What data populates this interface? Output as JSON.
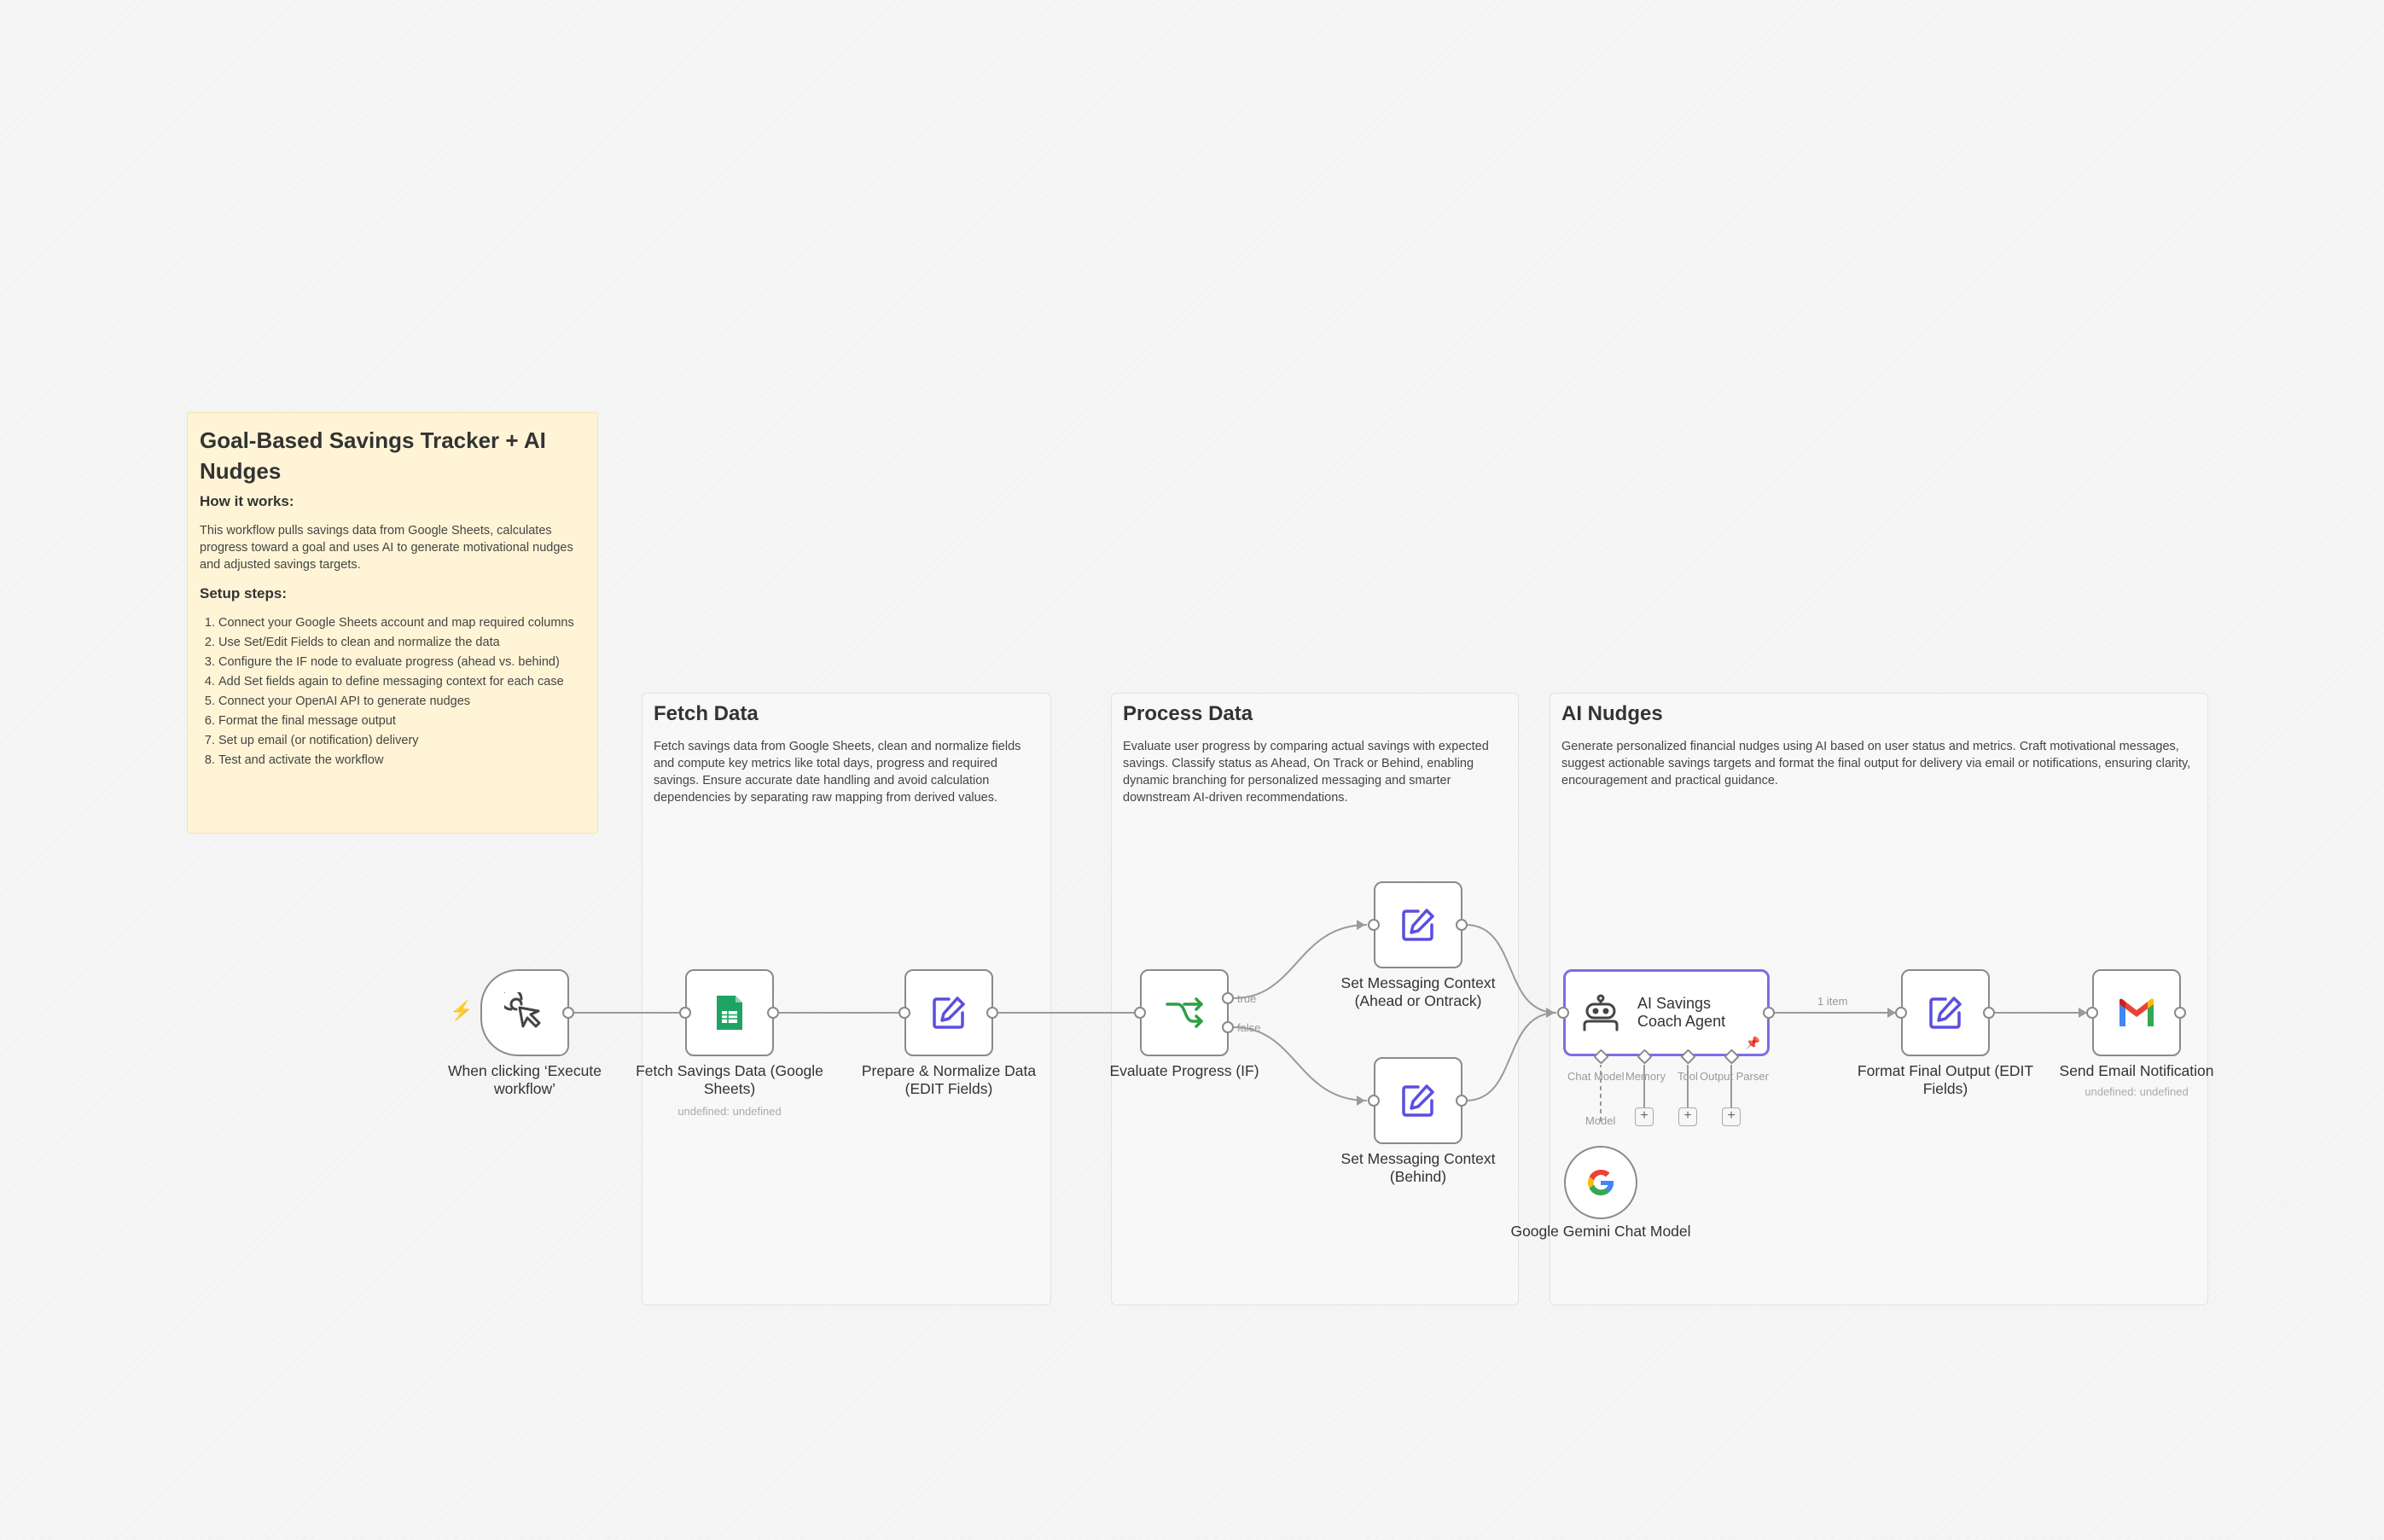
{
  "note": {
    "title": "Goal-Based Savings Tracker + AI Nudges",
    "how_heading": "How it works:",
    "how_text": "This workflow pulls savings data from Google Sheets, calculates progress toward a goal and uses AI to generate motivational nudges and adjusted savings targets.",
    "setup_heading": "Setup steps:",
    "steps": [
      "Connect your Google Sheets account and map required columns",
      "Use Set/Edit Fields to clean and normalize the data",
      "Configure the IF node to evaluate progress (ahead vs. behind)",
      "Add Set fields again to define messaging context for each case",
      "Connect your OpenAI API to generate nudges",
      "Format the final message output",
      "Set up email (or notification) delivery",
      "Test and activate the workflow"
    ]
  },
  "sections": {
    "fetch": {
      "title": "Fetch Data",
      "desc": "Fetch savings data from Google Sheets, clean and normalize fields and compute key metrics like total days, progress and required savings. Ensure accurate date handling and avoid calculation dependencies by separating raw mapping from derived values."
    },
    "process": {
      "title": "Process Data",
      "desc": "Evaluate user progress by comparing actual savings with expected savings. Classify status as Ahead, On Track or Behind, enabling dynamic branching for personalized messaging and smarter downstream AI-driven recommendations."
    },
    "ai": {
      "title": "AI Nudges",
      "desc": "Generate personalized financial nudges using AI based on user status and metrics. Craft motivational messages, suggest actionable savings targets and format the final output for delivery via email or notifications, ensuring clarity, encouragement and practical guidance."
    }
  },
  "nodes": {
    "trigger": {
      "label": "When clicking ‘Execute workflow’",
      "icon": "cursor-click-icon"
    },
    "sheets": {
      "label": "Fetch Savings Data (Google Sheets)",
      "sub": "undefined: undefined",
      "icon": "google-sheets-icon"
    },
    "prepare": {
      "label": "Prepare & Normalize Data (EDIT Fields)",
      "icon": "edit-icon"
    },
    "if": {
      "label": "Evaluate Progress (IF)",
      "icon": "branch-icon",
      "true_label": "true",
      "false_label": "false"
    },
    "set_ahead": {
      "label": "Set Messaging Context (Ahead or Ontrack)",
      "icon": "edit-icon"
    },
    "set_behind": {
      "label": "Set Messaging Context (Behind)",
      "icon": "edit-icon"
    },
    "agent": {
      "label": "AI Savings Coach Agent",
      "icon": "robot-icon",
      "ports": {
        "chat_model": "Chat Model",
        "memory": "Memory",
        "tool": "Tool",
        "output_parser": "Output Parser"
      }
    },
    "gemini": {
      "label": "Google Gemini Chat Model",
      "icon": "google-g-icon",
      "port_label": "Model"
    },
    "format": {
      "label": "Format Final Output (EDIT Fields)",
      "icon": "edit-icon"
    },
    "email": {
      "label": "Send Email Notification",
      "sub": "undefined: undefined",
      "icon": "gmail-icon"
    }
  },
  "connections": {
    "agent_to_format": "1 item"
  },
  "colors": {
    "accent": "#7b6ee6",
    "edit_icon": "#5b4ee0",
    "branch_icon": "#2f9e44",
    "trigger_bolt": "#ff6d5a",
    "note_bg": "#fff5d6"
  }
}
